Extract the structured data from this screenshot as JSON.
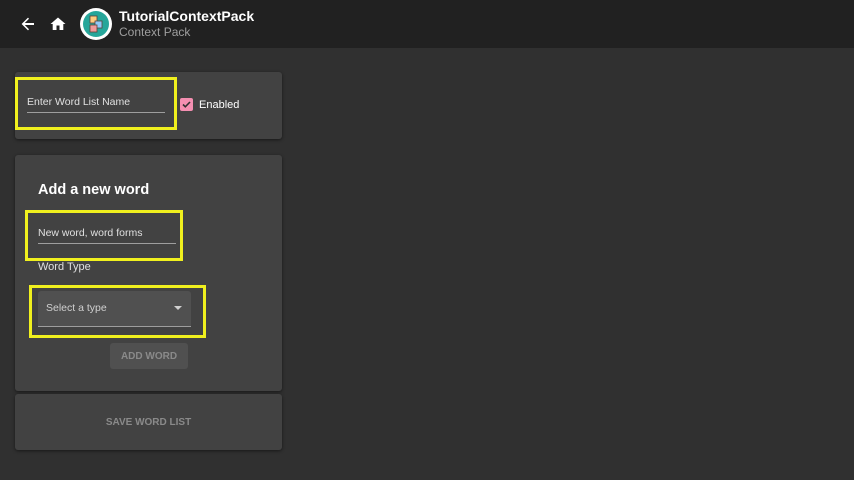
{
  "app_bar": {
    "title": "TutorialContextPack",
    "subtitle": "Context Pack",
    "back_icon": "arrow-back-icon",
    "home_icon": "home-icon",
    "logo_icon": "abc-blocks-icon"
  },
  "word_list": {
    "name_placeholder": "Enter Word List Name",
    "enabled_label": "Enabled",
    "enabled_checked": true
  },
  "add_word": {
    "title": "Add a new word",
    "word_placeholder": "New word, word forms",
    "word_type_label": "Word Type",
    "select_placeholder": "Select a type",
    "add_button": "ADD WORD"
  },
  "save_button": "SAVE WORD LIST",
  "colors": {
    "highlight": "#f0f01e",
    "checkbox": "#f48fb1",
    "background": "#303030",
    "card": "#424242",
    "app_bar": "#212121"
  }
}
